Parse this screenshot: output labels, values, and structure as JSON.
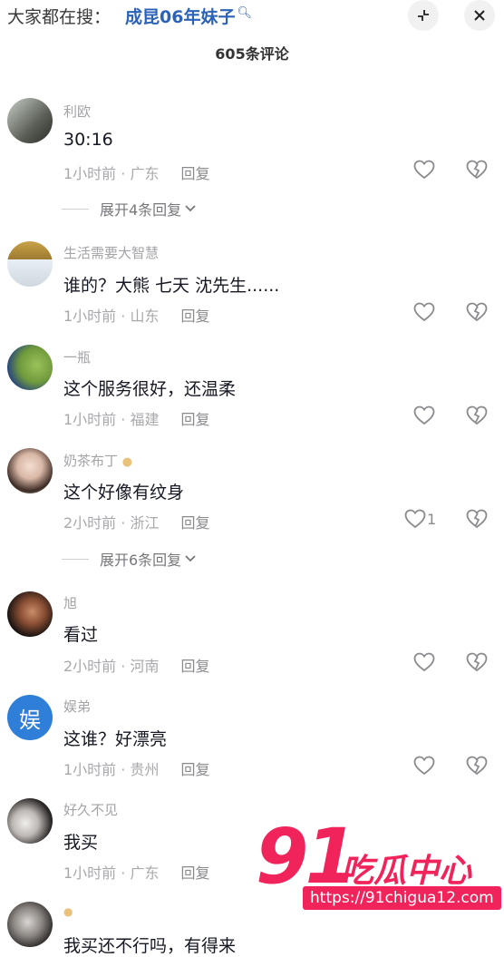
{
  "search": {
    "prefix": "大家都在搜：",
    "term": "成昆06年妹子"
  },
  "header": {
    "comment_count": "605条评论"
  },
  "comments": [
    {
      "user": "利欧",
      "text": "30:16",
      "time": "1小时前",
      "location": "广东",
      "reply": "回复",
      "likes": "",
      "expand": "展开4条回复"
    },
    {
      "user": "生活需要大智慧",
      "text": "谁的？大熊 七天 沈先生......",
      "time": "1小时前",
      "location": "山东",
      "reply": "回复",
      "likes": "",
      "expand": ""
    },
    {
      "user": "一瓶",
      "text": "这个服务很好，还温柔",
      "time": "1小时前",
      "location": "福建",
      "reply": "回复",
      "likes": "",
      "expand": ""
    },
    {
      "user": "奶茶布丁",
      "text": "这个好像有纹身",
      "time": "2小时前",
      "location": "浙江",
      "reply": "回复",
      "likes": "1",
      "expand": "展开6条回复"
    },
    {
      "user": "旭",
      "text": "看过",
      "time": "2小时前",
      "location": "河南",
      "reply": "回复",
      "likes": "",
      "expand": ""
    },
    {
      "user": "娱弟",
      "text": "这谁？好漂亮",
      "time": "1小时前",
      "location": "贵州",
      "reply": "回复",
      "likes": "",
      "expand": "",
      "avatar_char": "娱"
    },
    {
      "user": "好久不见",
      "text": "我买",
      "time": "1小时前",
      "location": "广东",
      "reply": "回复",
      "likes": "",
      "expand": ""
    },
    {
      "user": "",
      "text": "我买还不行吗，有得来",
      "time": "",
      "location": "",
      "reply": "",
      "likes": "",
      "expand": ""
    }
  ],
  "watermark": {
    "number": "91",
    "text": "吃瓜中心",
    "url": "https://91chigua12.com"
  },
  "colors": {
    "search_term": "#2c63b8",
    "watermark": "#f0245a",
    "meta": "#a8a8ad"
  }
}
